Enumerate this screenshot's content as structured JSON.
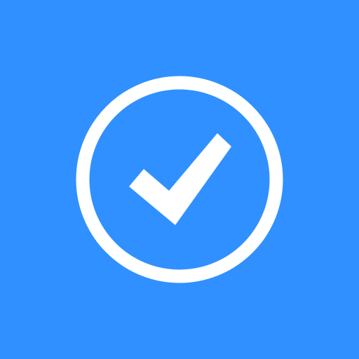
{
  "icon": {
    "name": "check-circle-icon",
    "background_color": "#3090ff",
    "foreground_color": "#ffffff"
  }
}
